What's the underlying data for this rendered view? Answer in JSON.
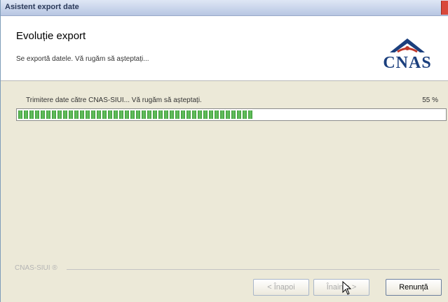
{
  "window": {
    "title": "Asistent export date"
  },
  "header": {
    "title": "Evoluție export",
    "subtitle": "Se exportă datele. Vă rugăm să așteptați..."
  },
  "logo": {
    "text": "CNAS",
    "icon": "cnas-logo-icon",
    "color": "#1b3f7d",
    "accent_color": "#c0392b"
  },
  "progress": {
    "label": "Trimitere date către CNAS-SIUI... Vă rugăm să așteptați.",
    "percent_text": "55 %",
    "value": 0.55,
    "color": "#3f9b3a"
  },
  "footer": {
    "label": "CNAS-SIUI ®"
  },
  "buttons": {
    "back": "< Înapoi",
    "next": "Înainte >",
    "cancel": "Renunță"
  }
}
